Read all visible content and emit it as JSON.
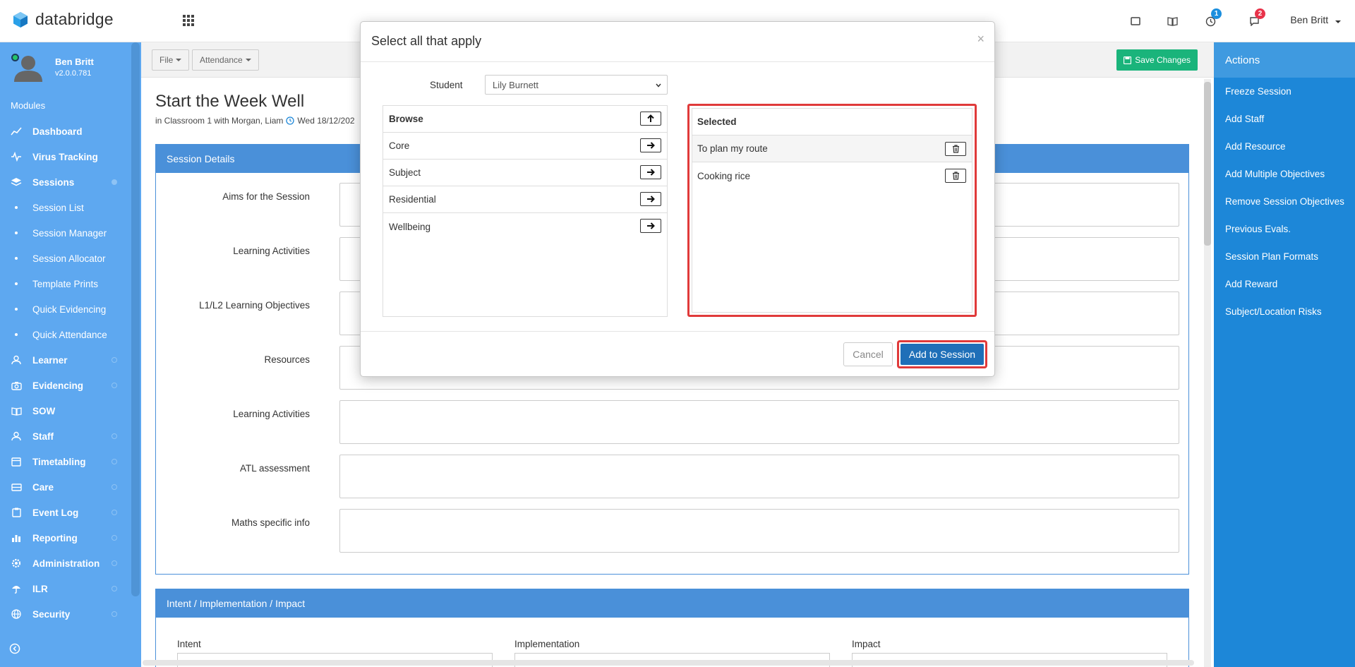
{
  "brand": {
    "name": "databridge",
    "color": "#2aa0e8"
  },
  "topbar": {
    "notifications": [
      {
        "icon": "tablet-icon",
        "badge": null
      },
      {
        "icon": "book-icon",
        "badge": null
      },
      {
        "icon": "clock-icon",
        "badge": "1",
        "badge_color": "#1b8fde"
      },
      {
        "icon": "chat-icon",
        "badge": "2",
        "badge_color": "#e8334a"
      }
    ],
    "user_name": "Ben Britt"
  },
  "sidebar": {
    "profile_name": "Ben Britt",
    "version": "v2.0.0.781",
    "modules_label": "Modules",
    "items": [
      {
        "label": "Dashboard",
        "icon": "dashboard-icon"
      },
      {
        "label": "Virus Tracking",
        "icon": "pulse-icon"
      },
      {
        "label": "Sessions",
        "icon": "layers-icon",
        "expanded": true,
        "children": [
          "Session List",
          "Session Manager",
          "Session Allocator",
          "Template Prints",
          "Quick Evidencing",
          "Quick Attendance"
        ]
      },
      {
        "label": "Learner",
        "icon": "user-icon"
      },
      {
        "label": "Evidencing",
        "icon": "camera-icon"
      },
      {
        "label": "SOW",
        "icon": "book-icon"
      },
      {
        "label": "Staff",
        "icon": "user-icon"
      },
      {
        "label": "Timetabling",
        "icon": "calendar-icon"
      },
      {
        "label": "Care",
        "icon": "care-icon"
      },
      {
        "label": "Event Log",
        "icon": "clipboard-icon"
      },
      {
        "label": "Reporting",
        "icon": "chart-icon"
      },
      {
        "label": "Administration",
        "icon": "gear-icon"
      },
      {
        "label": "ILR",
        "icon": "umbrella-icon"
      },
      {
        "label": "Security",
        "icon": "globe-icon"
      }
    ]
  },
  "toolbar": {
    "file": "File",
    "attendance": "Attendance",
    "save": "Save Changes"
  },
  "page": {
    "title": "Start the Week Well",
    "subtitle_prefix": "in Classroom 1 with Morgan, Liam",
    "subtitle_date": "Wed 18/12/202"
  },
  "session_details": {
    "title": "Session Details",
    "rows": [
      "Aims for the Session",
      "Learning Activities",
      "L1/L2 Learning Objectives",
      "Resources",
      "Learning Activities",
      "ATL assessment",
      "Maths specific info"
    ]
  },
  "iii": {
    "title": "Intent / Implementation / Impact",
    "intent": "Intent",
    "implementation": "Implementation",
    "impact": "Impact"
  },
  "actions": {
    "title": "Actions",
    "items": [
      "Freeze Session",
      "Add Staff",
      "Add Resource",
      "Add Multiple Objectives",
      "Remove Session Objectives",
      "Previous Evals.",
      "Session Plan Formats",
      "Add Reward",
      "Subject/Location Risks"
    ]
  },
  "modal": {
    "title": "Select all that apply",
    "close": "×",
    "student_label": "Student",
    "student_value": "Lily Burnett",
    "browse_header": "Browse",
    "browse_items": [
      "Core",
      "Subject",
      "Residential",
      "Wellbeing"
    ],
    "selected_header": "Selected",
    "selected_items": [
      "To plan my route",
      "Cooking rice"
    ],
    "cancel": "Cancel",
    "add": "Add to Session"
  }
}
